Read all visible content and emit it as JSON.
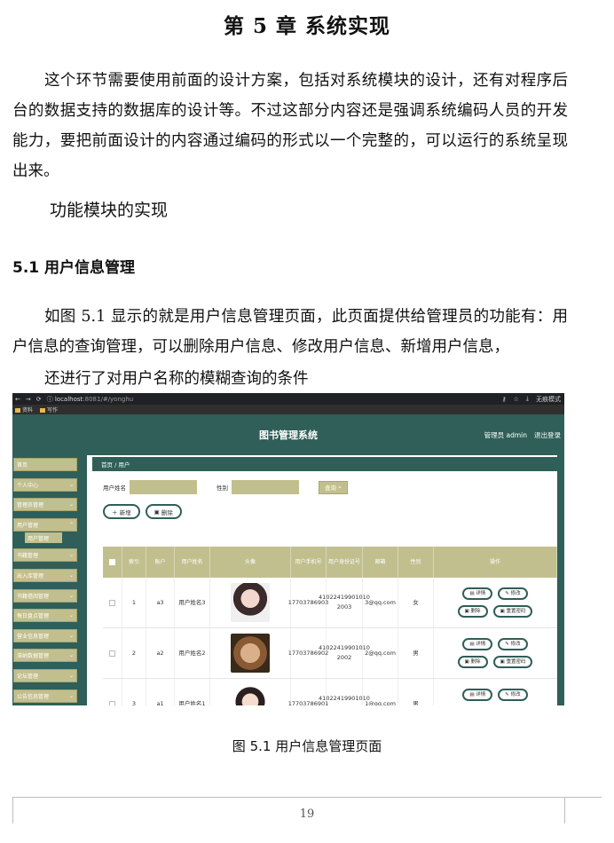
{
  "chapter_title": "第 5 章  系统实现",
  "intro_paragraph": "这个环节需要使用前面的设计方案，包括对系统模块的设计，还有对程序后台的数据支持的数据库的设计等。不过这部分内容还是强调系统编码人员的开发能力，要把前面设计的内容通过编码的形式以一个完整的，可以运行的系统呈现出来。",
  "section_heading": "功能模块的实现",
  "subsection_heading": "5.1 用户信息管理",
  "body_paragraph": "如图 5.1 显示的就是用户信息管理页面，此页面提供给管理员的功能有：用户信息的查询管理，可以删除用户信息、修改用户信息、新增用户信息，",
  "body_paragraph_tail": "还进行了对用户名称的模糊查询的条件",
  "screenshot": {
    "browser": {
      "url_host": "localhost",
      "url_path": ":8081/#/yonghu",
      "right_label": "无痕模式",
      "bookmarks": [
        "资料",
        "写作"
      ]
    },
    "app": {
      "title": "图书管理系统",
      "user_label": "管理员 admin",
      "logout_label": "退出登录"
    },
    "sidebar": {
      "items": [
        "首页",
        "个人中心",
        "管理员管理",
        "用户管理",
        "书籍管理",
        "出入库管理",
        "书籍借阅管理",
        "每日盘点管理",
        "营业信息管理",
        "滞纳数据管理",
        "论坛管理",
        "公告信息管理"
      ],
      "active_sub": "用户管理"
    },
    "breadcrumb": "首页  /  用户",
    "search": {
      "name_label": "用户姓名",
      "gender_label": "性别",
      "query_button": "查询"
    },
    "actions": {
      "add_label": "新增",
      "delete_label": "删除"
    },
    "table": {
      "headers": [
        "",
        "索引",
        "账户",
        "用户姓名",
        "头像",
        "用户手机号",
        "用户身份证号",
        "邮箱",
        "性别",
        "操作"
      ],
      "rows": [
        {
          "index": "1",
          "account": "a3",
          "name": "用户姓名3",
          "phone": "17703786903",
          "id_card": "41022419901010 2003",
          "email": "3@qq.com",
          "gender": "女"
        },
        {
          "index": "2",
          "account": "a2",
          "name": "用户姓名2",
          "phone": "17703786902",
          "id_card": "41022419901010 2002",
          "email": "2@qq.com",
          "gender": "男"
        },
        {
          "index": "3",
          "account": "a1",
          "name": "用户姓名1",
          "phone": "17703786901",
          "id_card": "41022419901010 2001",
          "email": "1@qq.com",
          "gender": "男"
        }
      ],
      "op_labels": {
        "detail": "详情",
        "edit": "修改",
        "delete": "删除",
        "reset": "重置密码"
      }
    }
  },
  "caption": "图 5.1 用户信息管理页面",
  "page_number": "19"
}
